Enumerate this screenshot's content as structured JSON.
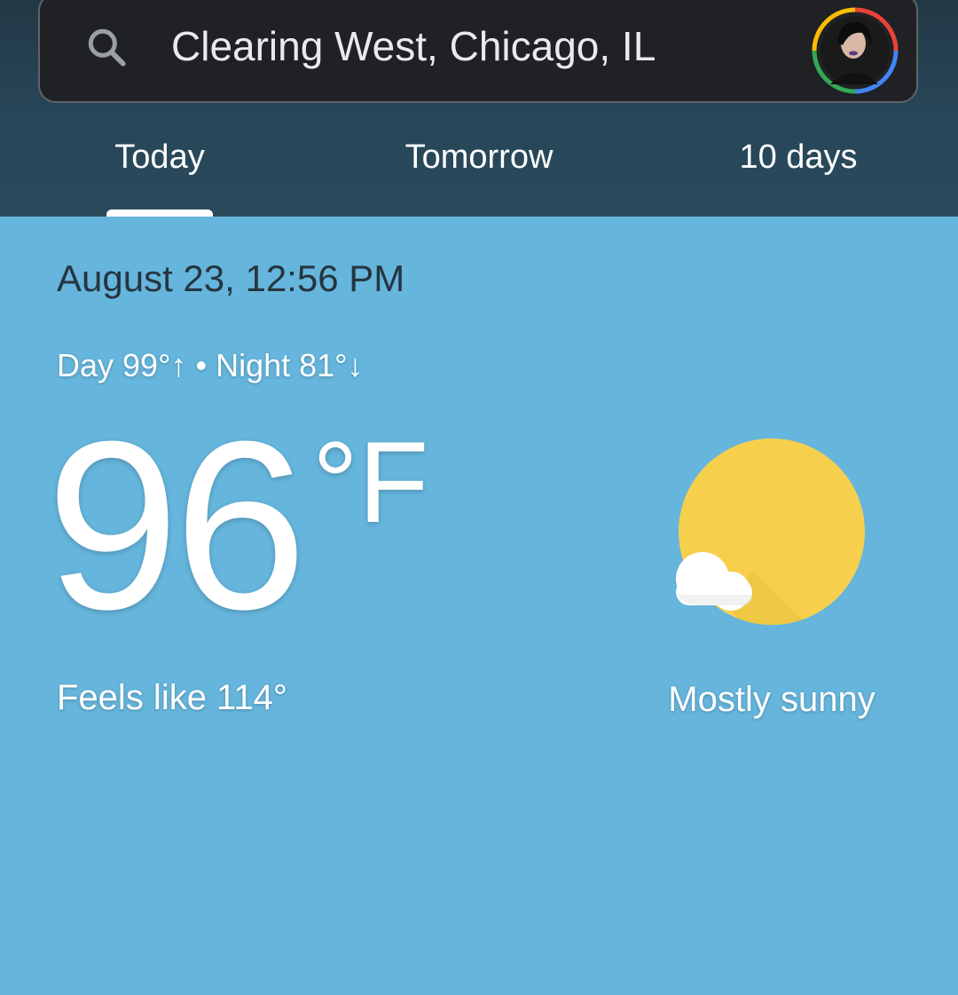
{
  "search": {
    "location": "Clearing West, Chicago, IL",
    "search_icon": "search-icon",
    "avatar_icon": "account-avatar"
  },
  "tabs": [
    {
      "label": "Today",
      "selected": true
    },
    {
      "label": "Tomorrow",
      "selected": false
    },
    {
      "label": "10 days",
      "selected": false
    }
  ],
  "weather": {
    "datetime": "August 23, 12:56 PM",
    "day_night": "Day 99°↑ • Night 81°↓",
    "temperature": "96",
    "unit": "°F",
    "feels_like": "Feels like 114°",
    "condition": "Mostly sunny",
    "condition_icon": "mostly-sunny-icon"
  },
  "colors": {
    "header_bg": "#28485a",
    "content_bg": "#65b5dc",
    "sun": "#f6d04d",
    "search_bg": "#202125"
  }
}
